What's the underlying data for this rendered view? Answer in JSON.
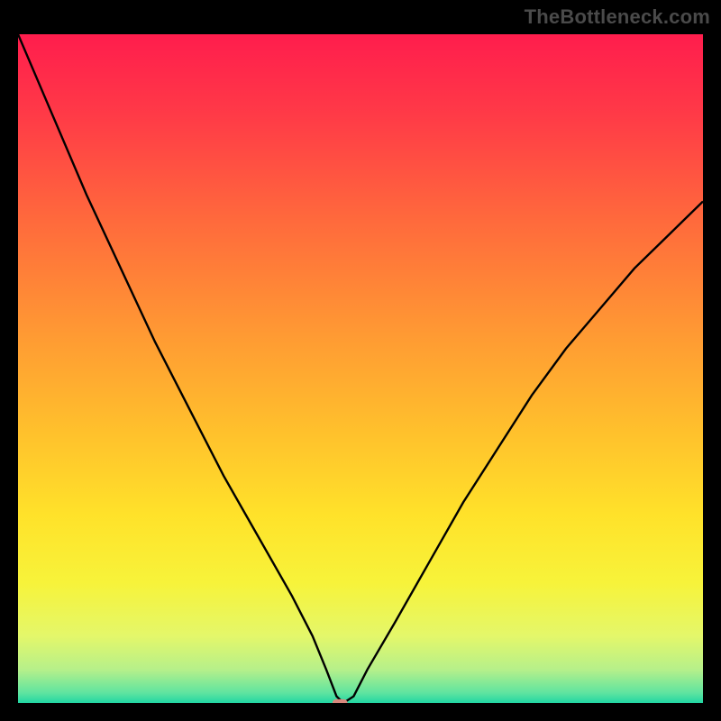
{
  "watermark": "TheBottleneck.com",
  "chart_data": {
    "type": "line",
    "title": "",
    "xlabel": "",
    "ylabel": "",
    "xlim": [
      0,
      100
    ],
    "ylim": [
      0,
      100
    ],
    "grid": false,
    "legend_position": "none",
    "note": "V-shaped bottleneck curve over vertical rainbow gradient. Minimum near x≈47, y≈0. Values are read off the plot proportionally (no axis ticks visible).",
    "series": [
      {
        "name": "bottleneck-curve",
        "color": "#000000",
        "x": [
          0,
          5,
          10,
          15,
          20,
          25,
          30,
          35,
          40,
          43,
          45,
          46.5,
          47.5,
          49,
          51,
          55,
          60,
          65,
          70,
          75,
          80,
          85,
          90,
          95,
          100
        ],
        "y": [
          100,
          88,
          76,
          65,
          54,
          44,
          34,
          25,
          16,
          10,
          5,
          1,
          0,
          1,
          5,
          12,
          21,
          30,
          38,
          46,
          53,
          59,
          65,
          70,
          75
        ]
      }
    ],
    "marker": {
      "name": "minimum-pill",
      "shape": "rounded-rect",
      "color": "#d9887d",
      "x": 47,
      "y": 0,
      "width_pct": 2.2,
      "height_pct": 1.1
    },
    "background_gradient": {
      "direction": "vertical",
      "stops": [
        {
          "offset": 0.0,
          "color": "#ff1d4d"
        },
        {
          "offset": 0.12,
          "color": "#ff3a47"
        },
        {
          "offset": 0.28,
          "color": "#ff6a3c"
        },
        {
          "offset": 0.45,
          "color": "#ff9a33"
        },
        {
          "offset": 0.6,
          "color": "#ffc22c"
        },
        {
          "offset": 0.72,
          "color": "#ffe22a"
        },
        {
          "offset": 0.82,
          "color": "#f7f33a"
        },
        {
          "offset": 0.9,
          "color": "#e4f76a"
        },
        {
          "offset": 0.95,
          "color": "#b6f08a"
        },
        {
          "offset": 0.985,
          "color": "#5fe4a0"
        },
        {
          "offset": 1.0,
          "color": "#21d6a3"
        }
      ]
    }
  }
}
